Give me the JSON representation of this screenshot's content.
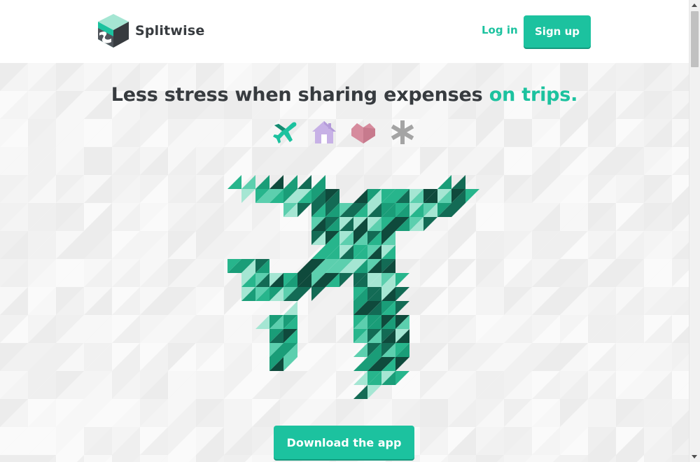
{
  "header": {
    "brand_name": "Splitwise",
    "login_label": "Log in",
    "signup_label": "Sign up"
  },
  "hero": {
    "headline_main": "Less stress when sharing expenses",
    "headline_accent": "on trips.",
    "category_icons": [
      "airplane-icon",
      "house-icon",
      "heart-icon",
      "asterisk-icon"
    ],
    "download_label": "Download the app"
  },
  "colors": {
    "brand_green": "#1cc29f",
    "text_dark": "#373b3f",
    "icon_purple": "#c7b1e6",
    "icon_pink": "#d68b9d",
    "icon_gray": "#a4a4a4",
    "art_dark": "#0f4a3c",
    "art_mid": "#1a9d78",
    "art_light": "#a5e6d3"
  }
}
